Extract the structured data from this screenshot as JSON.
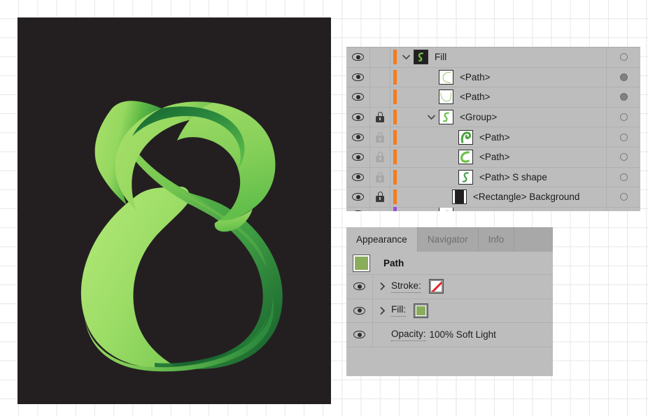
{
  "app": {
    "accent_orange": "#f47b20",
    "accent_purple": "#9b4dd8",
    "panel_bg": "#bdbdbd",
    "tab_inactive_bg": "#a8a8a8"
  },
  "canvas": {
    "name": "artboard",
    "background_color": "#231f20",
    "artwork": {
      "description": "3D ribbon letter S",
      "gradient_light": "#a8e06a",
      "gradient_mid": "#6cc04a",
      "gradient_dark": "#1f7a3d",
      "gradient_darkest": "#14602f"
    }
  },
  "layers_panel": {
    "name": "layers-panel",
    "columns": {
      "visibility": "eye-icon",
      "lock": "lock-icon",
      "color_bar": "layer-color-bar",
      "target": "target-circle"
    },
    "rows": [
      {
        "label": "Fill",
        "indent": 0,
        "visible": true,
        "eye": "eye-icon",
        "lock": "none",
        "bar_color": "#f47b20",
        "expanded": true,
        "chevron": "chevron-down-icon",
        "thumb": "layer-thumb-dark-s",
        "target": "ring"
      },
      {
        "label": "<Path>",
        "indent": 1,
        "visible": true,
        "eye": "eye-icon",
        "lock": "none",
        "bar_color": "#f47b20",
        "expanded": false,
        "chevron": "none",
        "thumb": "path-thumb-curve-upper",
        "target": "dot"
      },
      {
        "label": "<Path>",
        "indent": 1,
        "visible": true,
        "eye": "eye-icon",
        "lock": "none",
        "bar_color": "#f47b20",
        "expanded": false,
        "chevron": "none",
        "thumb": "path-thumb-curve-lower",
        "target": "dot"
      },
      {
        "label": "<Group>",
        "indent": 1,
        "visible": true,
        "eye": "eye-icon",
        "lock": "locked",
        "bar_color": "#f47b20",
        "expanded": true,
        "chevron": "chevron-down-icon",
        "thumb": "group-thumb-s",
        "target": "ring"
      },
      {
        "label": "<Path>",
        "indent": 2,
        "visible": true,
        "eye": "eye-icon",
        "lock": "locked-dim",
        "bar_color": "#f47b20",
        "expanded": false,
        "chevron": "none",
        "thumb": "path-thumb-hook-top",
        "target": "ring"
      },
      {
        "label": "<Path>",
        "indent": 2,
        "visible": true,
        "eye": "eye-icon",
        "lock": "locked-dim",
        "bar_color": "#f47b20",
        "expanded": false,
        "chevron": "none",
        "thumb": "path-thumb-hook-bottom",
        "target": "ring"
      },
      {
        "label": "<Path> S shape",
        "indent": 2,
        "visible": true,
        "eye": "eye-icon",
        "lock": "locked-dim",
        "bar_color": "#f47b20",
        "expanded": false,
        "chevron": "none",
        "thumb": "path-thumb-s-shape",
        "target": "ring"
      },
      {
        "label": "<Rectangle> Background",
        "indent": 1,
        "visible": true,
        "eye": "eye-icon",
        "lock": "locked",
        "bar_color": "#f47b20",
        "expanded": false,
        "chevron": "none",
        "thumb": "rect-thumb-black",
        "target": "ring"
      },
      {
        "label": "",
        "indent": 1,
        "visible": true,
        "eye": "eye-icon",
        "lock": "none",
        "bar_color": "#9b4dd8",
        "expanded": false,
        "chevron": "none",
        "thumb": "clipped-row-thumb",
        "target": "none",
        "clipped": true
      }
    ]
  },
  "appearance_panel": {
    "name": "appearance-panel",
    "tabs": [
      {
        "label": "Appearance",
        "active": true
      },
      {
        "label": "Navigator",
        "active": false
      },
      {
        "label": "Info",
        "active": false
      }
    ],
    "selection": {
      "title": "Path",
      "thumb_color": "#8aad5c"
    },
    "attributes": [
      {
        "label": "Stroke:",
        "value": "",
        "swatch": "none-swatch",
        "swatch_color": "#ffffff",
        "slash_color": "#e8232a",
        "eye": "eye-icon",
        "disclosure": "chevron-right-icon"
      },
      {
        "label": "Fill:",
        "value": "",
        "swatch": "color-swatch",
        "swatch_color": "#8aad5c",
        "eye": "eye-icon",
        "disclosure": "chevron-right-icon"
      },
      {
        "label": "Opacity:",
        "value": "100% Soft Light",
        "swatch": "none",
        "eye": "eye-icon",
        "disclosure": "none"
      }
    ]
  }
}
